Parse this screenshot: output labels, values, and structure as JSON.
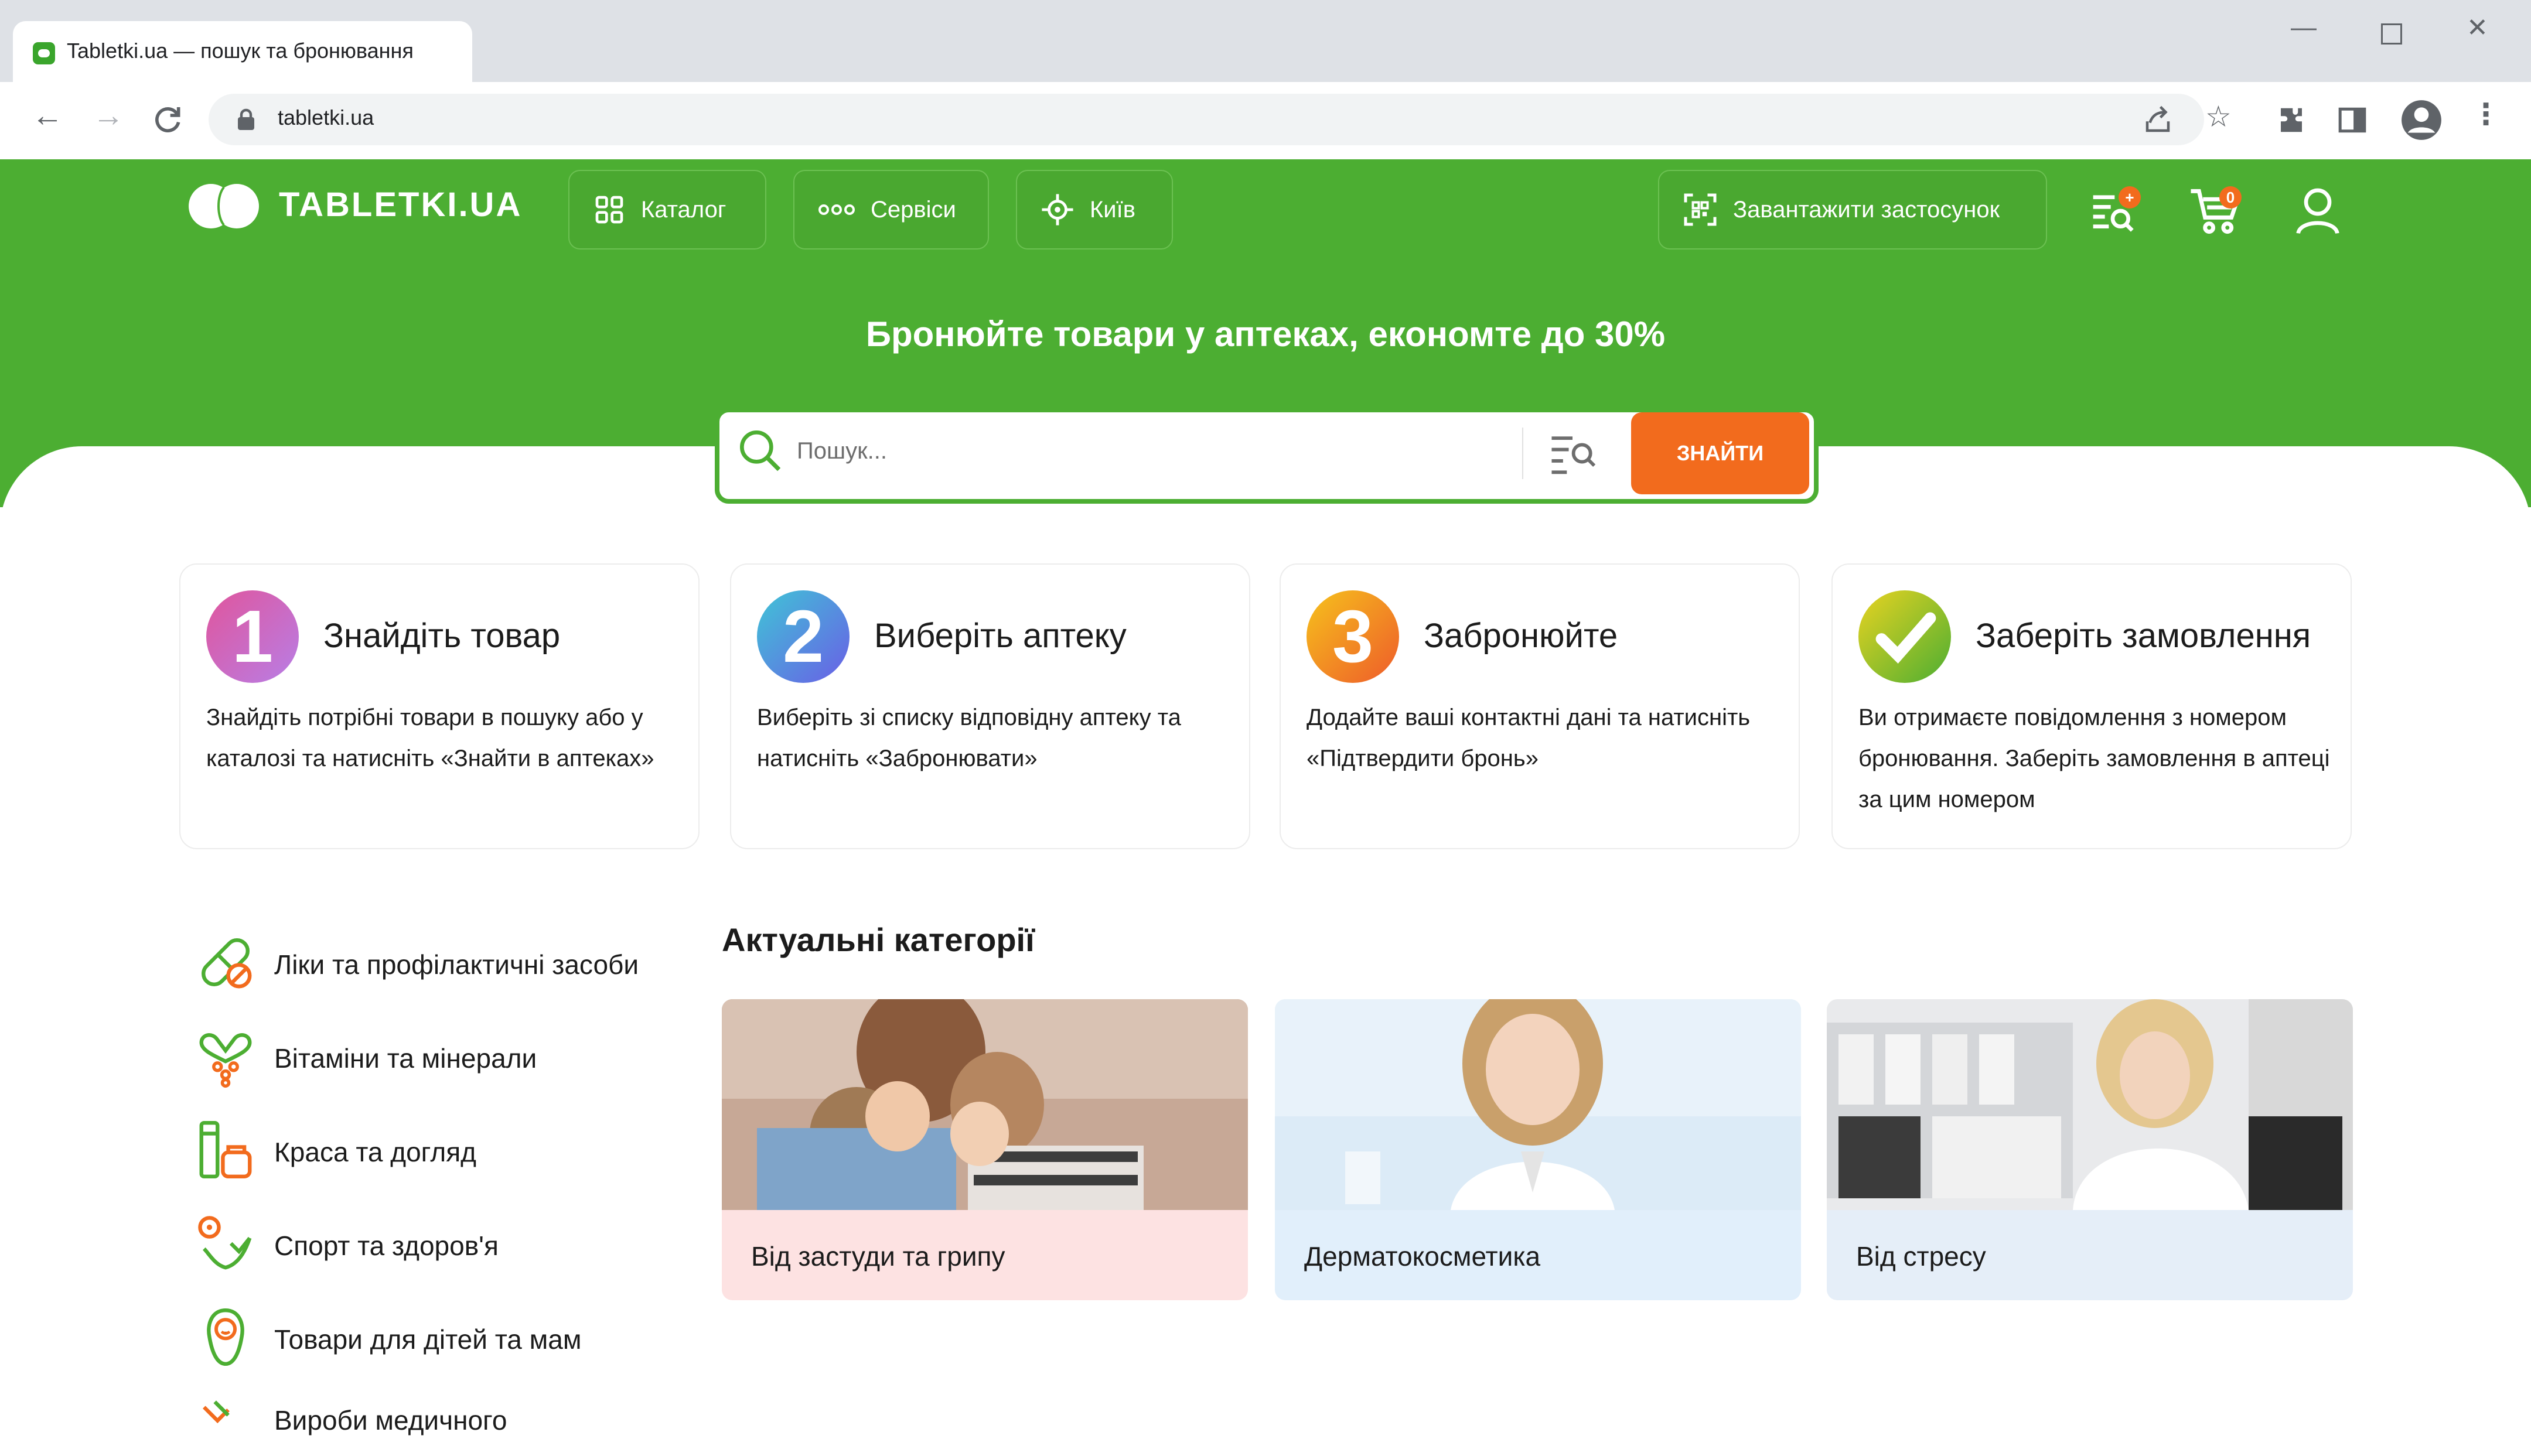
{
  "browser": {
    "tab_title": "Tabletki.ua — пошук та бронювання",
    "url": "tabletki.ua"
  },
  "header": {
    "logo_text": "TABLETKI.UA",
    "catalog_label": "Каталог",
    "services_label": "Сервіси",
    "city_label": "Київ",
    "download_app_label": "Завантажити застосунок",
    "search_list_badge": "+",
    "cart_count": "0",
    "hero_title": "Бронюйте товари у аптеках, економте до 30%"
  },
  "search": {
    "placeholder": "Пошук...",
    "button_label": "ЗНАЙТИ"
  },
  "steps": [
    {
      "num": "1",
      "title": "Знайдіть товар",
      "desc": "Знайдіть потрібні товари в пошуку або у каталозі та натисніть «Знайти в аптеках»"
    },
    {
      "num": "2",
      "title": "Виберіть аптеку",
      "desc": "Виберіть зі списку відповідну аптеку та натисніть «Забронювати»"
    },
    {
      "num": "3",
      "title": "Забронюйте",
      "desc": "Додайте ваші контактні дані та натисніть «Підтвердити бронь»"
    },
    {
      "num": "",
      "title": "Заберіть замовлення",
      "desc": "Ви отримаєте повідомлення з номером бронювання. Заберіть замовлення в аптеці за цим номером"
    }
  ],
  "sidebar": {
    "items": [
      {
        "label": "Ліки та профілактичні засоби",
        "icon": "pill-icon"
      },
      {
        "label": "Вітаміни та мінерали",
        "icon": "vitamins-icon"
      },
      {
        "label": "Краса та догляд",
        "icon": "cosmetics-icon"
      },
      {
        "label": "Спорт та здоров'я",
        "icon": "sport-icon"
      },
      {
        "label": "Товари для дітей та мам",
        "icon": "baby-icon"
      },
      {
        "label": "Вироби медичного",
        "icon": "medical-icon"
      }
    ]
  },
  "categories": {
    "title": "Актуальні категорії",
    "cards": [
      {
        "label": "Від застуди та грипу",
        "bg": "#fde2e2"
      },
      {
        "label": "Дерматокосметика",
        "bg": "#e1effb"
      },
      {
        "label": "Від стресу",
        "bg": "#e5eef8"
      }
    ]
  },
  "colors": {
    "brand_green": "#4cae32",
    "accent_orange": "#f26b1d"
  }
}
